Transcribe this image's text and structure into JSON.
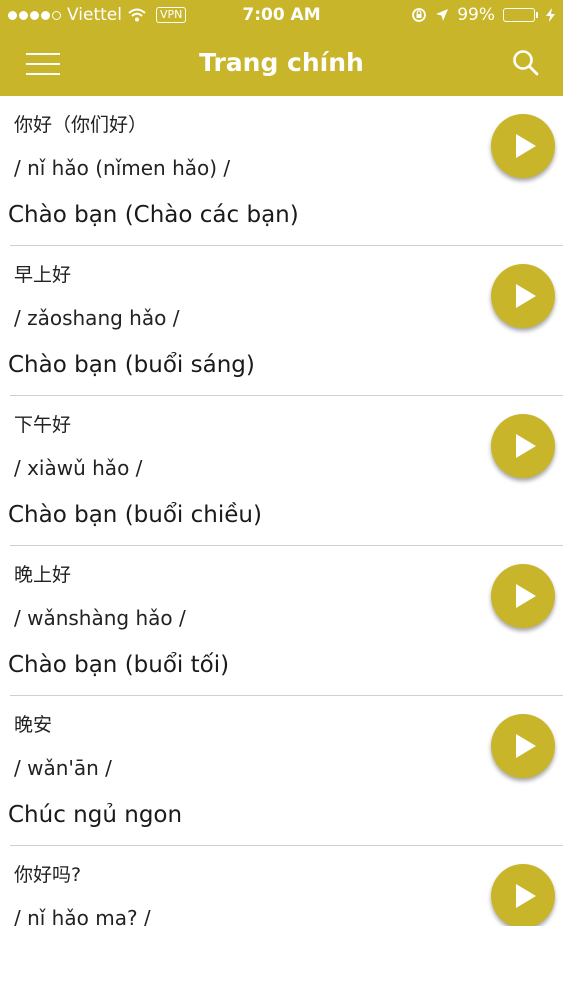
{
  "status_bar": {
    "carrier": "Viettel",
    "vpn": "VPN",
    "time": "7:00 AM",
    "battery": "99%",
    "battery_level": 0.99
  },
  "header": {
    "title": "Trang chính",
    "menu_icon": "hamburger-menu-icon",
    "search_icon": "search-icon"
  },
  "colors": {
    "accent": "#c9b52a",
    "battery_green": "#4cd964"
  },
  "phrases": [
    {
      "hanzi": "你好（你们好）",
      "pinyin": "/ nǐ hǎo (nǐmen hǎo) /",
      "meaning": "Chào bạn (Chào các bạn)"
    },
    {
      "hanzi": "早上好",
      "pinyin": "/ zǎoshang hǎo /",
      "meaning": "Chào bạn (buổi sáng)"
    },
    {
      "hanzi": "下午好",
      "pinyin": "/ xiàwǔ hǎo /",
      "meaning": "Chào bạn (buổi chiều)"
    },
    {
      "hanzi": "晚上好",
      "pinyin": "/ wǎnshàng hǎo /",
      "meaning": "Chào bạn (buổi tối)"
    },
    {
      "hanzi": "晚安",
      "pinyin": "/ wǎn'ān /",
      "meaning": "Chúc ngủ ngon"
    },
    {
      "hanzi": "你好吗?",
      "pinyin": "/ nǐ hǎo ma? /",
      "meaning": ""
    }
  ]
}
